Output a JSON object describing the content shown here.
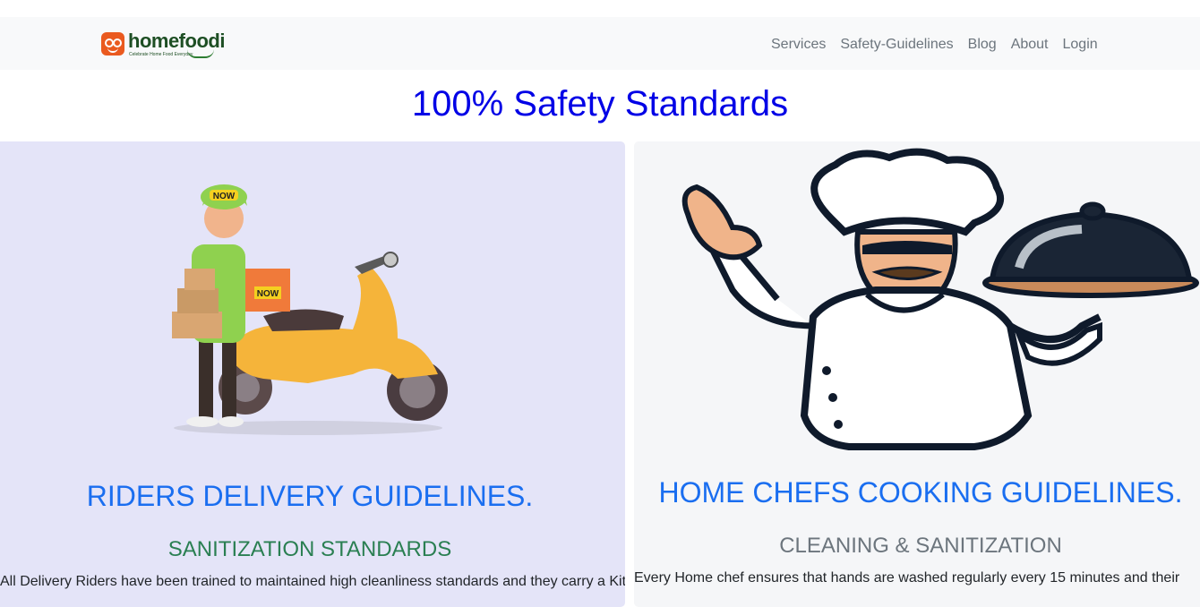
{
  "navbar": {
    "brand_name": "homefoodi",
    "brand_tagline": "Celebrate Home Food Everyday",
    "links": [
      "Services",
      "Safety-Guidelines",
      "Blog",
      "About",
      "Login"
    ]
  },
  "hero": {
    "title": "100% Safety Standards"
  },
  "cards": [
    {
      "image_icon": "delivery-rider-scooter-illustration",
      "badge_text": "NOW",
      "title": "RIDERS DELIVERY GUIDELINES.",
      "subtitle": "SANITIZATION STANDARDS",
      "text": "All Delivery Riders have been trained to maintained high cleanliness standards and they carry a Kit"
    },
    {
      "image_icon": "chef-serving-cloche-illustration",
      "title": "HOME CHEFS COOKING GUIDELINES.",
      "subtitle": "CLEANING & SANITIZATION",
      "text": "Every Home chef ensures that hands are washed regularly every 15 minutes and their"
    }
  ],
  "colors": {
    "brand_orange": "#ea5a1f",
    "brand_green": "#1e4f24",
    "hero_title": "#0000e6",
    "card_title": "#1a6ef0",
    "rider_subtitle": "#2a7f52",
    "chef_subtitle": "#6c757d"
  }
}
